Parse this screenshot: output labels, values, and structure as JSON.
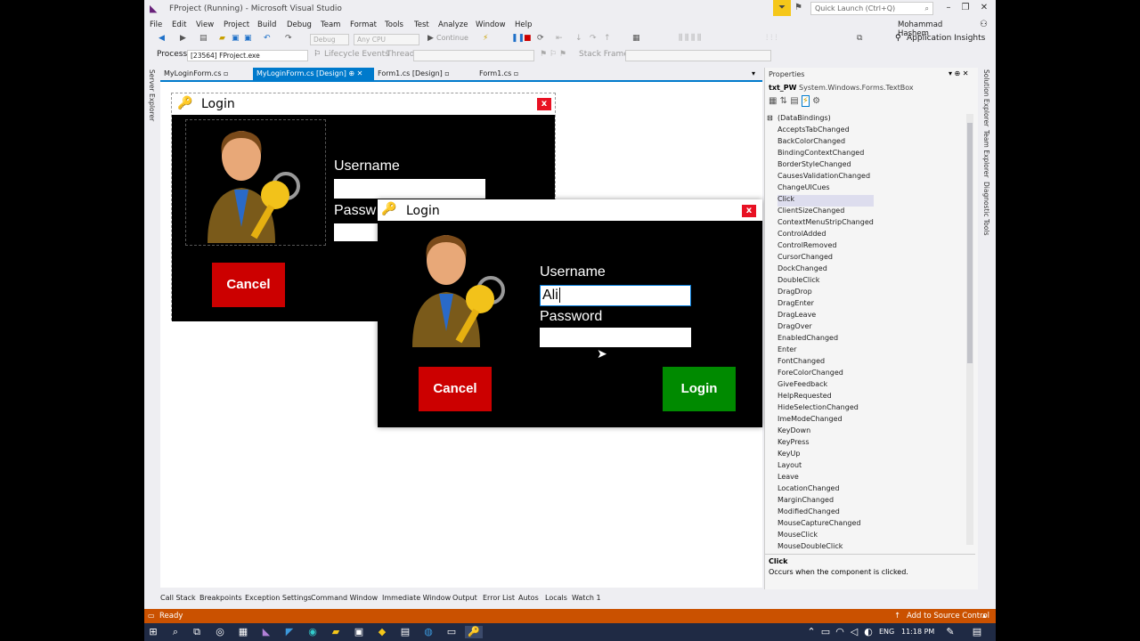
{
  "window": {
    "title": "FProject (Running) - Microsoft Visual Studio",
    "quick_launch_placeholder": "Quick Launch (Ctrl+Q)",
    "user": "Mohammad Hashem"
  },
  "menu": [
    "File",
    "Edit",
    "View",
    "Project",
    "Build",
    "Debug",
    "Team",
    "Format",
    "Tools",
    "Test",
    "Analyze",
    "Window",
    "Help"
  ],
  "toolbar": {
    "config": "Debug",
    "platform": "Any CPU",
    "continue": "Continue",
    "app_insights": "Application Insights",
    "process_label": "Process:",
    "process_value": "[23564] FProject.exe",
    "lifecycle": "Lifecycle Events",
    "thread_label": "Thread:",
    "stack_label": "Stack Frame:"
  },
  "tabs": [
    {
      "label": "MyLoginForm.cs"
    },
    {
      "label": "MyLoginForm.cs [Design]"
    },
    {
      "label": "Form1.cs [Design]"
    },
    {
      "label": "Form1.cs"
    }
  ],
  "left_strip": {
    "label": "Server Explorer"
  },
  "right_strip": [
    "Solution Explorer",
    "Team Explorer",
    "Diagnostic Tools"
  ],
  "design_form": {
    "title": "Login",
    "username_label": "Username",
    "password_label": "Passw",
    "cancel": "Cancel"
  },
  "running_form": {
    "title": "Login",
    "username_label": "Username",
    "username_value": "Ali",
    "password_label": "Password",
    "password_value": "",
    "cancel": "Cancel",
    "login": "Login"
  },
  "properties": {
    "header": "Properties",
    "object_name": "txt_PW",
    "object_type": "System.Windows.Forms.TextBox",
    "group": "(DataBindings)",
    "events": [
      "AcceptsTabChanged",
      "BackColorChanged",
      "BindingContextChanged",
      "BorderStyleChanged",
      "CausesValidationChanged",
      "ChangeUICues",
      "Click",
      "ClientSizeChanged",
      "ContextMenuStripChanged",
      "ControlAdded",
      "ControlRemoved",
      "CursorChanged",
      "DockChanged",
      "DoubleClick",
      "DragDrop",
      "DragEnter",
      "DragLeave",
      "DragOver",
      "EnabledChanged",
      "Enter",
      "FontChanged",
      "ForeColorChanged",
      "GiveFeedback",
      "HelpRequested",
      "HideSelectionChanged",
      "ImeModeChanged",
      "KeyDown",
      "KeyPress",
      "KeyUp",
      "Layout",
      "Leave",
      "LocationChanged",
      "MarginChanged",
      "ModifiedChanged",
      "MouseCaptureChanged",
      "MouseClick",
      "MouseDoubleClick"
    ],
    "highlighted": "Click",
    "desc_title": "Click",
    "desc_text": "Occurs when the component is clicked."
  },
  "bottom_tabs": [
    "Call Stack",
    "Breakpoints",
    "Exception Settings",
    "Command Window",
    "Immediate Window",
    "Output",
    "Error List",
    "Autos",
    "Locals",
    "Watch 1"
  ],
  "status": {
    "left": "Ready",
    "right": "Add to Source Control"
  },
  "taskbar": {
    "lang": "ENG",
    "time": "11:18 PM"
  }
}
